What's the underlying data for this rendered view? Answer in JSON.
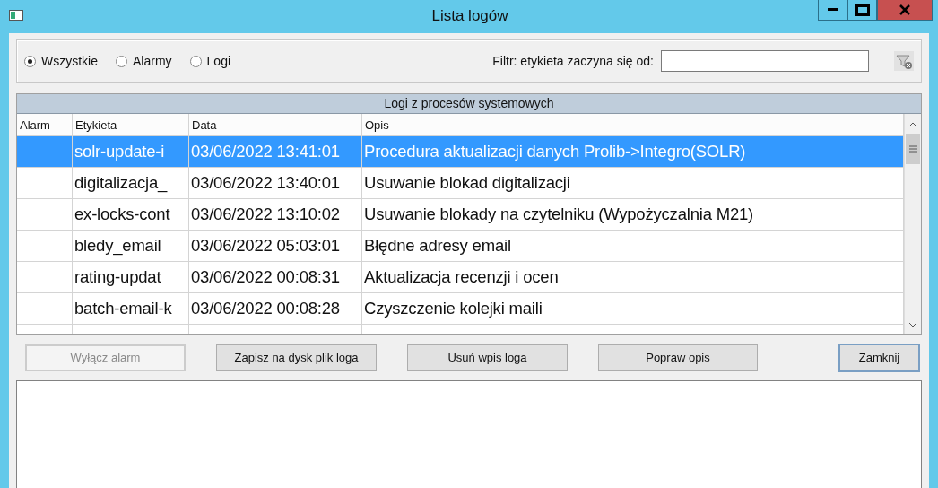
{
  "window": {
    "title": "Lista logów"
  },
  "filter_options": [
    {
      "label": "Wszystkie",
      "selected": true
    },
    {
      "label": "Alarmy",
      "selected": false
    },
    {
      "label": "Logi",
      "selected": false
    }
  ],
  "filter": {
    "label": "Filtr: etykieta zaczyna się od:"
  },
  "table": {
    "title": "Logi z procesów systemowych",
    "columns": [
      "Alarm",
      "Etykieta",
      "Data",
      "Opis"
    ],
    "rows": [
      {
        "cells": [
          "",
          "solr-update-i",
          "03/06/2022 13:41:01",
          "Procedura aktualizacji danych Prolib->Integro(SOLR)"
        ],
        "selected": true
      },
      {
        "cells": [
          "",
          "digitalizacja_",
          "03/06/2022 13:40:01",
          "Usuwanie blokad digitalizacji"
        ],
        "selected": false
      },
      {
        "cells": [
          "",
          "ex-locks-cont",
          "03/06/2022 13:10:02",
          "Usuwanie blokady na czytelniku (Wypożyczalnia M21)"
        ],
        "selected": false
      },
      {
        "cells": [
          "",
          "bledy_email",
          "03/06/2022 05:03:01",
          "Błędne adresy email"
        ],
        "selected": false
      },
      {
        "cells": [
          "",
          "rating-updat",
          "03/06/2022 00:08:31",
          "Aktualizacja recenzji i ocen"
        ],
        "selected": false
      },
      {
        "cells": [
          "",
          "batch-email-k",
          "03/06/2022 00:08:28",
          "Czyszczenie kolejki maili"
        ],
        "selected": false
      }
    ]
  },
  "buttons": [
    {
      "label": "Wyłącz alarm",
      "disabled": true,
      "default": false
    },
    {
      "label": "Zapisz na dysk plik loga",
      "disabled": false,
      "default": false
    },
    {
      "label": "Usuń wpis loga",
      "disabled": false,
      "default": false
    },
    {
      "label": "Popraw opis",
      "disabled": false,
      "default": false
    },
    {
      "label": "Zamknij",
      "disabled": false,
      "default": true
    }
  ]
}
